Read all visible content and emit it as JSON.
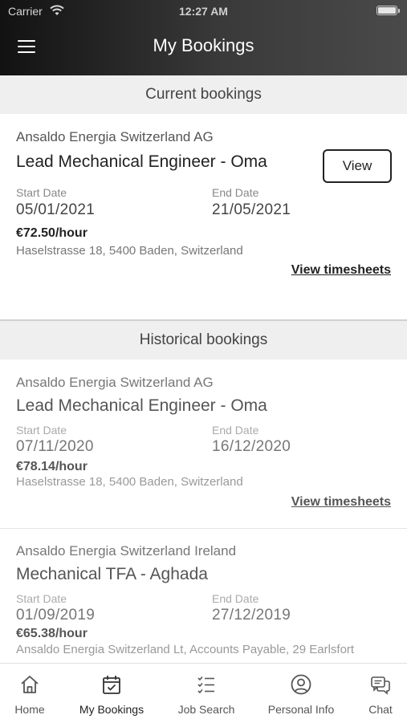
{
  "status": {
    "carrier": "Carrier",
    "time": "12:27 AM"
  },
  "header": {
    "title": "My Bookings"
  },
  "current": {
    "heading": "Current bookings",
    "booking": {
      "company": "Ansaldo Energia Switzerland AG",
      "role": "Lead Mechanical Engineer - Oma",
      "view_label": "View",
      "start_label": "Start Date",
      "start": "05/01/2021",
      "end_label": "End Date",
      "end": "21/05/2021",
      "rate": "€72.50/hour",
      "address": "Haselstrasse 18, 5400 Baden, Switzerland",
      "timesheets": "View timesheets"
    }
  },
  "historical": {
    "heading": "Historical bookings",
    "bookings": [
      {
        "company": "Ansaldo Energia Switzerland AG",
        "role": "Lead Mechanical Engineer - Oma",
        "start_label": "Start Date",
        "start": "07/11/2020",
        "end_label": "End Date",
        "end": "16/12/2020",
        "rate": "€78.14/hour",
        "address": "Haselstrasse 18, 5400 Baden, Switzerland",
        "timesheets": "View timesheets"
      },
      {
        "company": "Ansaldo Energia Switzerland Ireland",
        "role": "Mechanical TFA - Aghada",
        "start_label": "Start Date",
        "start": "01/09/2019",
        "end_label": "End Date",
        "end": "27/12/2019",
        "rate": "€65.38/hour",
        "address": "Ansaldo Energia Switzerland Lt, Accounts Payable, 29 Earlsfort"
      }
    ]
  },
  "tabs": [
    {
      "label": "Home",
      "icon": "home-icon"
    },
    {
      "label": "My Bookings",
      "icon": "calendar-check-icon",
      "active": true
    },
    {
      "label": "Job Search",
      "icon": "checklist-icon"
    },
    {
      "label": "Personal Info",
      "icon": "user-circle-icon"
    },
    {
      "label": "Chat",
      "icon": "chat-icon"
    }
  ]
}
